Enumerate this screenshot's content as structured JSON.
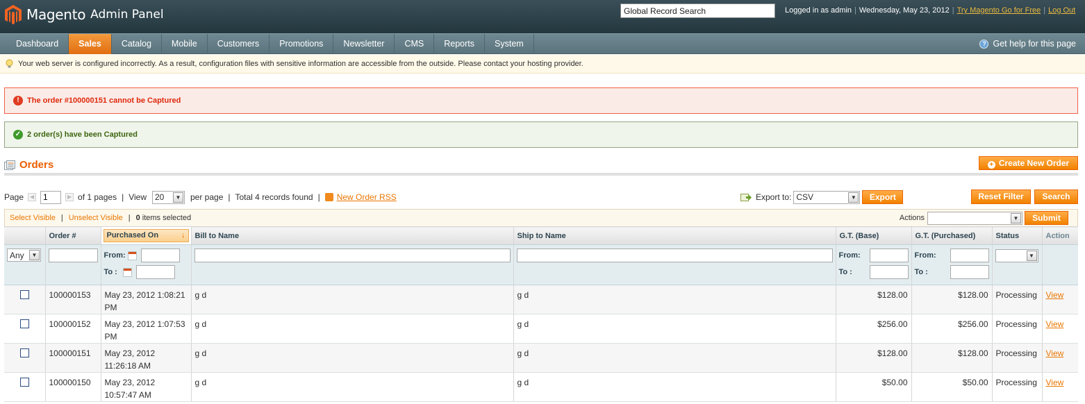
{
  "header": {
    "logo_brand": "Magento",
    "logo_suffix": "Admin Panel",
    "search_value": "Global Record Search",
    "logged_in": "Logged in as admin",
    "date": "Wednesday, May 23, 2012",
    "try_link": "Try Magento Go for Free",
    "logout_link": "Log Out"
  },
  "nav": {
    "items": [
      "Dashboard",
      "Sales",
      "Catalog",
      "Mobile",
      "Customers",
      "Promotions",
      "Newsletter",
      "CMS",
      "Reports",
      "System"
    ],
    "active": "Sales",
    "help": "Get help for this page"
  },
  "notice": "Your web server is configured incorrectly. As a result, configuration files with sensitive information are accessible from the outside. Please contact your hosting provider.",
  "messages": {
    "error": "The order #100000151 cannot be Captured",
    "success": "2 order(s) have been Captured"
  },
  "page": {
    "title": "Orders",
    "create_button": "Create New Order"
  },
  "pager": {
    "page_label": "Page",
    "page_value": "1",
    "of_pages": "of 1 pages",
    "view_label": "View",
    "per_page_value": "20",
    "per_page_label": "per page",
    "total": "Total 4 records found",
    "rss": "New Order RSS",
    "export_label": "Export to:",
    "export_value": "CSV",
    "export_button": "Export",
    "reset_button": "Reset Filter",
    "search_button": "Search"
  },
  "massaction": {
    "select_visible": "Select Visible",
    "unselect_visible": "Unselect Visible",
    "selected_count": "0",
    "selected_label": "items selected",
    "actions_label": "Actions",
    "submit_button": "Submit"
  },
  "grid": {
    "columns": [
      "",
      "Order #",
      "Purchased On",
      "Bill to Name",
      "Ship to Name",
      "G.T. (Base)",
      "G.T. (Purchased)",
      "Status",
      "Action"
    ],
    "filter": {
      "any": "Any",
      "from": "From:",
      "to": "To :"
    },
    "rows": [
      {
        "order": "100000153",
        "purchased": "May 23, 2012 1:08:21 PM",
        "bill": "g d",
        "ship": "g d",
        "base": "$128.00",
        "purchased_total": "$128.00",
        "status": "Processing",
        "action": "View"
      },
      {
        "order": "100000152",
        "purchased": "May 23, 2012 1:07:53 PM",
        "bill": "g d",
        "ship": "g d",
        "base": "$256.00",
        "purchased_total": "$256.00",
        "status": "Processing",
        "action": "View"
      },
      {
        "order": "100000151",
        "purchased": "May 23, 2012 11:26:18 AM",
        "bill": "g d",
        "ship": "g d",
        "base": "$128.00",
        "purchased_total": "$128.00",
        "status": "Processing",
        "action": "View"
      },
      {
        "order": "100000150",
        "purchased": "May 23, 2012 10:57:47 AM",
        "bill": "g d",
        "ship": "g d",
        "base": "$50.00",
        "purchased_total": "$50.00",
        "status": "Processing",
        "action": "View"
      }
    ]
  },
  "colors": {
    "accent": "#eb5e00",
    "header_bg": "#2f434c",
    "nav_bg": "#637b84",
    "error": "#df280a",
    "success": "#3d6611"
  }
}
